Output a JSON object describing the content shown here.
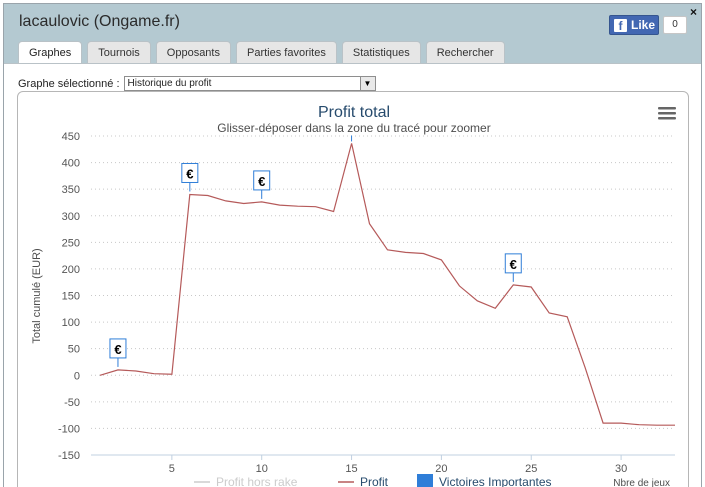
{
  "window": {
    "title": "lacaulovic (Ongame.fr)",
    "close": "×"
  },
  "facebook": {
    "like_label": "Like",
    "count": "0",
    "icon": "facebook-f-icon"
  },
  "tabs": [
    {
      "label": "Graphes",
      "active": true
    },
    {
      "label": "Tournois",
      "active": false
    },
    {
      "label": "Opposants",
      "active": false
    },
    {
      "label": "Parties favorites",
      "active": false
    },
    {
      "label": "Statistiques",
      "active": false
    },
    {
      "label": "Rechercher",
      "active": false
    }
  ],
  "selector": {
    "label": "Graphe sélectionné :",
    "value": "Historique du profit"
  },
  "chart_data": {
    "type": "line",
    "title": "Profit total",
    "subtitle": "Glisser-déposer dans la zone du tracé pour zoomer",
    "xlabel": "Nbre de jeux",
    "ylabel": "Total cumulé (EUR)",
    "xlim": [
      0.5,
      33
    ],
    "ylim": [
      -150,
      450
    ],
    "yticks": [
      -150,
      -100,
      -50,
      0,
      50,
      100,
      150,
      200,
      250,
      300,
      350,
      400,
      450
    ],
    "xticks": [
      5,
      10,
      15,
      20,
      25,
      30
    ],
    "grid": true,
    "series": [
      {
        "name": "Profit",
        "color": "#b55a5a",
        "x": [
          1,
          2,
          3,
          4,
          5,
          6,
          7,
          8,
          9,
          10,
          11,
          12,
          13,
          14,
          15,
          16,
          17,
          18,
          19,
          20,
          21,
          22,
          23,
          24,
          25,
          26,
          27,
          28,
          29,
          30,
          31,
          32,
          33
        ],
        "values": [
          0,
          10,
          8,
          3,
          2,
          340,
          338,
          328,
          323,
          326,
          320,
          318,
          317,
          308,
          436,
          285,
          236,
          231,
          229,
          217,
          168,
          140,
          126,
          170,
          166,
          117,
          110,
          14,
          -90,
          -90,
          -93,
          -94,
          -94
        ]
      }
    ],
    "markers": [
      {
        "label": "€",
        "x": 2,
        "y": 10
      },
      {
        "label": "€",
        "x": 6,
        "y": 340
      },
      {
        "label": "€",
        "x": 10,
        "y": 326
      },
      {
        "label": "€",
        "x": 24,
        "y": 170
      }
    ],
    "legend": [
      {
        "name": "Profit hors rake",
        "color": "#cccccc",
        "kind": "line"
      },
      {
        "name": "Profit",
        "color": "#b55a5a",
        "kind": "line"
      },
      {
        "name": "Victoires Importantes",
        "color": "#2f7ed8",
        "kind": "flag"
      }
    ],
    "legend_position": "bottom-center"
  },
  "chart_menu_icon": "menu-icon"
}
